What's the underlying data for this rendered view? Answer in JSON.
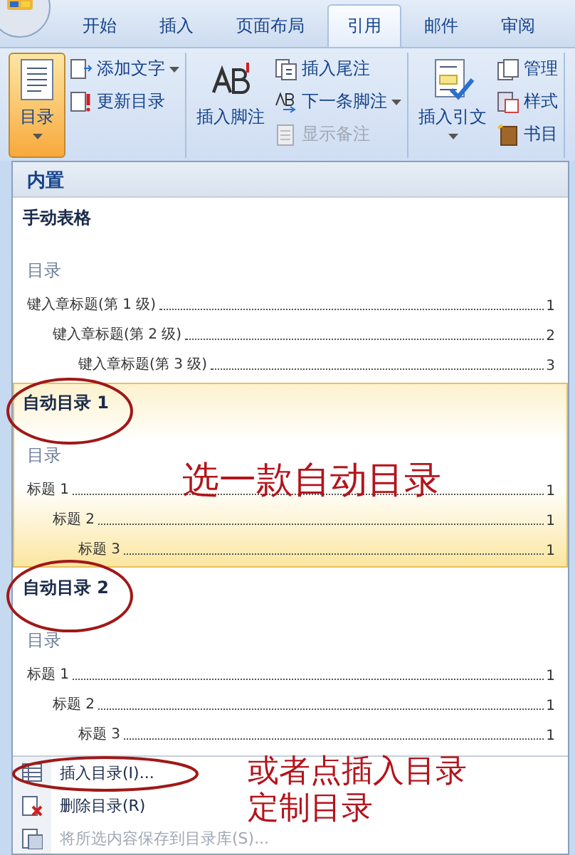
{
  "tabs": [
    {
      "label": "开始",
      "selected": false
    },
    {
      "label": "插入",
      "selected": false
    },
    {
      "label": "页面布局",
      "selected": false
    },
    {
      "label": "引用",
      "selected": true
    },
    {
      "label": "邮件",
      "selected": false
    },
    {
      "label": "审阅",
      "selected": false
    }
  ],
  "ribbon": {
    "groups": [
      {
        "big": {
          "label": "目录",
          "pressed": true,
          "dropdown": true
        },
        "small": [
          {
            "label": "添加文字",
            "dropdown": true,
            "disabled": false
          },
          {
            "label": "更新目录",
            "dropdown": false,
            "disabled": false
          }
        ]
      },
      {
        "big": {
          "label": "插入脚注",
          "pressed": false,
          "dropdown": false
        },
        "small": [
          {
            "label": "插入尾注",
            "dropdown": false,
            "disabled": false
          },
          {
            "label": "下一条脚注",
            "dropdown": true,
            "disabled": false
          },
          {
            "label": "显示备注",
            "dropdown": false,
            "disabled": true
          }
        ]
      },
      {
        "big": {
          "label": "插入引文",
          "pressed": false,
          "dropdown": true
        },
        "small": [
          {
            "label": "管理",
            "dropdown": false,
            "disabled": false
          },
          {
            "label": "样式",
            "dropdown": false,
            "disabled": false
          },
          {
            "label": "书目",
            "dropdown": false,
            "disabled": false
          }
        ]
      }
    ]
  },
  "gallery": {
    "header": "内置",
    "entries": [
      {
        "title": "手动表格",
        "selected": false,
        "toc_title": "目录",
        "lines": [
          {
            "text": "键入章标题(第 1 级)",
            "page": "1",
            "children": [
              {
                "text": "键入章标题(第 2 级)",
                "page": "2",
                "children": [
                  {
                    "text": "键入章标题(第 3 级)",
                    "page": "3"
                  }
                ]
              }
            ]
          }
        ]
      },
      {
        "title": "自动目录 1",
        "selected": true,
        "toc_title": "目录",
        "lines": [
          {
            "text": "标题 1",
            "page": "1",
            "children": [
              {
                "text": "标题 2",
                "page": "1",
                "children": [
                  {
                    "text": "标题 3",
                    "page": "1"
                  }
                ]
              }
            ]
          }
        ]
      },
      {
        "title": "自动目录 2",
        "selected": false,
        "toc_title": "目录",
        "lines": [
          {
            "text": "标题 1",
            "page": "1",
            "children": [
              {
                "text": "标题 2",
                "page": "1",
                "children": [
                  {
                    "text": "标题 3",
                    "page": "1"
                  }
                ]
              }
            ]
          }
        ]
      }
    ]
  },
  "menu_items": [
    {
      "label": "插入目录(I)...",
      "disabled": false
    },
    {
      "label": "删除目录(R)",
      "disabled": false
    },
    {
      "label": "将所选内容保存到目录库(S)...",
      "disabled": true
    }
  ],
  "annotations": [
    "选一款自动目录",
    "或者点插入目录",
    "定制目录"
  ]
}
